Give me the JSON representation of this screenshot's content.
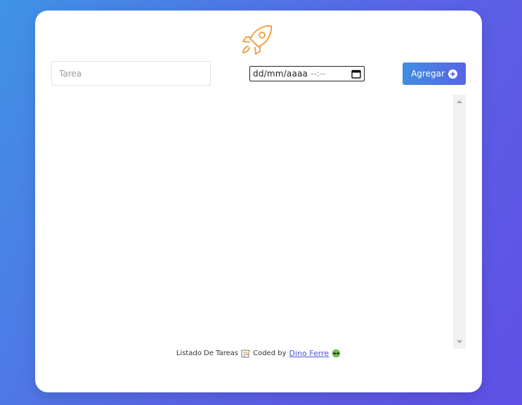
{
  "form": {
    "task_placeholder": "Tarea",
    "task_value": "",
    "date_placeholder": "dd/mm/aaaa",
    "time_placeholder": "--:--",
    "add_label": "Agregar"
  },
  "icons": {
    "logo": "rocket-icon",
    "calendar": "calendar-icon",
    "add": "plus-circle-icon",
    "memo": "memo-icon",
    "alien": "alien-icon"
  },
  "footer": {
    "text": "Listado De Tareas",
    "coded_by": "Coded by",
    "author": "Dino Ferre"
  },
  "colors": {
    "accent": "#5865e6",
    "logo": "#f0a24a",
    "link": "#4a55c9"
  },
  "tasks": []
}
